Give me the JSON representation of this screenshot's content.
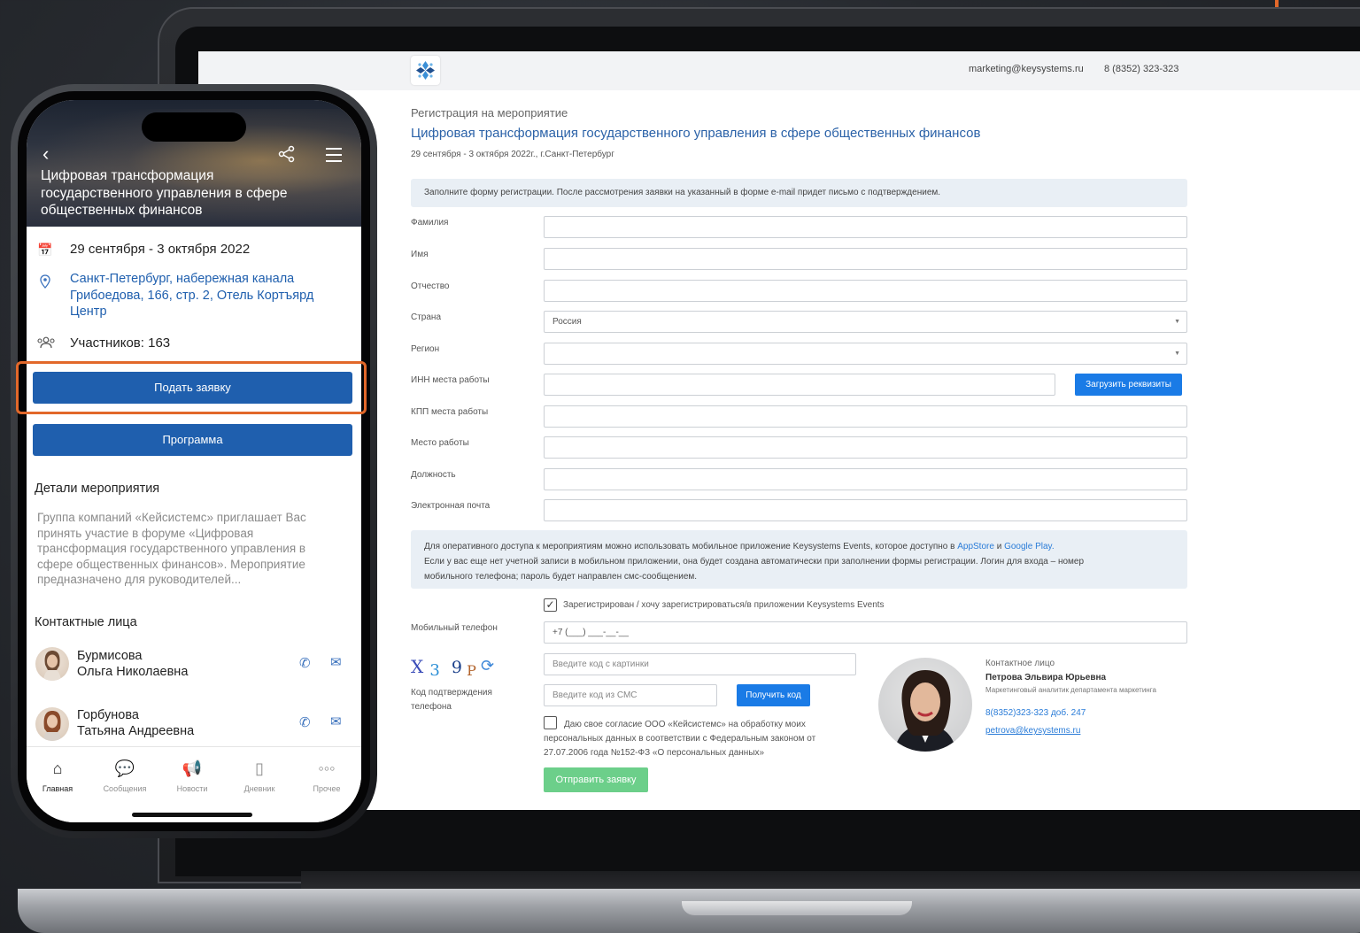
{
  "colors": {
    "accent_blue": "#1f5fae",
    "link_blue": "#2a7cd8",
    "button_blue": "#1a7be6",
    "submit_green": "#6ccf8a",
    "highlight_orange": "#e2682a"
  },
  "site": {
    "header": {
      "email": "marketing@keysystems.ru",
      "phone": "8 (8352) 323-323"
    },
    "breadcrumb": "Регистрация на мероприятие",
    "event_title": "Цифровая трансформация государственного управления в сфере общественных финансов",
    "event_dates": "29 сентября - 3 октября 2022г., г.Санкт-Петербург",
    "info_text": "Заполните форму регистрации. После рассмотрения заявки на указанный в форме e-mail придет письмо с подтверждением.",
    "form": {
      "last_name_label": "Фамилия",
      "first_name_label": "Имя",
      "patronymic_label": "Отчество",
      "country_label": "Страна",
      "country_value": "Россия",
      "region_label": "Регион",
      "inn_label": "ИНН места работы",
      "upload_button": "Загрузить реквизиты",
      "kpp_label": "КПП места работы",
      "workplace_label": "Место работы",
      "position_label": "Должность",
      "email_label": "Электронная почта",
      "app_info_line1": "Для оперативного доступа к мероприятиям можно использовать мобильное приложение Keysystems Events, которое доступно в",
      "app_store": "AppStore",
      "and": "и",
      "google_play": "Google Play.",
      "app_info_line2": "Если у вас еще нет учетной записи в мобильном приложении, она будет создана автоматически при заполнении формы регистрации. Логин для входа – номер",
      "app_info_line3": "мобильного телефона; пароль будет направлен смс-сообщением.",
      "register_in_app_label": "Зарегистрирован / хочу зарегистрироваться/в приложении Keysystems Events",
      "mobile_label": "Мобильный телефон",
      "mobile_value": "+7 (___) ___-__-__",
      "captcha_chars": [
        "X",
        "3",
        "9",
        "P"
      ],
      "captcha_placeholder": "Введите код с картинки",
      "sms_placeholder": "Введите код из СМС",
      "get_code_button": "Получить код",
      "confirm_label_1": "Код подтверждения",
      "confirm_label_2": "телефона",
      "consent_line1": "Даю свое согласие ООО «Кейсистемс» на обработку моих",
      "consent_line2": "персональных данных в соответствии с Федеральным законом от",
      "consent_line3": "27.07.2006 года №152-ФЗ «О персональных данных»",
      "submit_button": "Отправить заявку"
    },
    "contact": {
      "label": "Контактное лицо",
      "name": "Петрова Эльвира Юрьевна",
      "role": "Маркетинговый аналитик департамента маркетинга",
      "phone": "8(8352)323-323 доб. 247",
      "email": "petrova@keysystems.ru"
    }
  },
  "phone": {
    "hero_title": "Цифровая трансформация государственного управления в сфере общественных финансов",
    "date": "29 сентября - 3 октября 2022",
    "address": "Санкт-Петербург,  набережная канала Грибоедова, 166, стр. 2, Отель Кортъярд Центр",
    "participants": "Участников: 163",
    "apply_button": "Подать заявку",
    "program_button": "Программа",
    "details_title": "Детали мероприятия",
    "details_text": "Группа компаний «Кейсистемс» приглашает Вас принять участие в форуме «Цифровая трансформация государственного управления в сфере общественных финансов». Мероприятие предназначено для руководителей...",
    "contacts_title": "Контактные лица",
    "contacts": [
      {
        "surname": "Бурмисова",
        "given": "Ольга Николаевна"
      },
      {
        "surname": "Горбунова",
        "given": "Татьяна Андреевна"
      }
    ],
    "tabs": [
      {
        "label": "Главная",
        "icon": "home-icon"
      },
      {
        "label": "Сообщения",
        "icon": "chat-icon"
      },
      {
        "label": "Новости",
        "icon": "megaphone-icon"
      },
      {
        "label": "Дневник",
        "icon": "diary-icon"
      },
      {
        "label": "Прочее",
        "icon": "more-icon"
      }
    ]
  }
}
